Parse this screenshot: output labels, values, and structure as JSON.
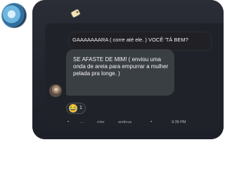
{
  "screen": {
    "accent": "#21232d",
    "outgoing_bubble_color": "#202025",
    "incoming_bubble_color": "#3a3f44",
    "text_color": "#f2f2f2"
  },
  "icons": {
    "profile_avatar": "avatar",
    "tag_icon": "tag-icon",
    "incoming_avatar": "avatar",
    "reaction_emoji": "laughing-emoji-icon"
  },
  "messages": [
    {
      "type": "outgoing",
      "text": "GAAAAAAARA ( corre até ele. ) VOCÊ 'TÁ BEM?"
    },
    {
      "type": "incoming",
      "text": "SE AFASTE DE MIM! ( enviou uma onda de areia para empurrar a mulher pelada pra longe. )"
    }
  ],
  "reaction": {
    "emoji": "😂",
    "count": "1"
  },
  "composer": {
    "left_label": "ınter",
    "middle_label": "andieus",
    "time": "9:39 PM"
  }
}
